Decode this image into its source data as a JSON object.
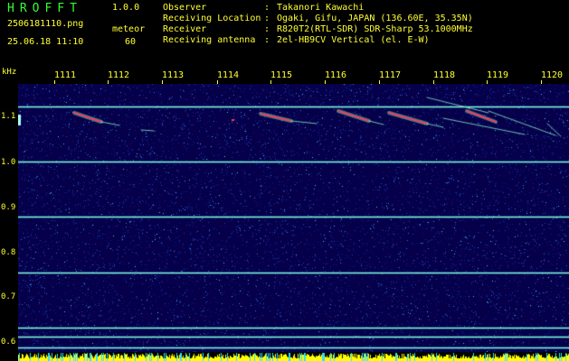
{
  "header": {
    "app_title": "HROFFT",
    "app_version": "1.0.0",
    "file_name": "2506181110.png",
    "meteor_label": "meteor",
    "date_time": "25.06.18 11:10",
    "meteor_count": "60"
  },
  "info": [
    {
      "label": "Observer",
      "value": "Takanori Kawachi"
    },
    {
      "label": "Receiving Location",
      "value": "Ogaki, Gifu, JAPAN (136.60E, 35.35N)"
    },
    {
      "label": "Receiver",
      "value": "R820T2(RTL-SDR) SDR-Sharp 53.1000MHz"
    },
    {
      "label": "Receiving antenna",
      "value": "2el-HB9CV Vertical (el. E-W)"
    }
  ],
  "axis": {
    "freq_unit": "kHz",
    "time_ticks": [
      "1111",
      "1112",
      "1113",
      "1114",
      "1115",
      "1116",
      "1117",
      "1118",
      "1119",
      "1120"
    ],
    "freq_ticks": [
      "1.1",
      "1.0",
      "0.9",
      "0.8",
      "0.7",
      "0.6"
    ]
  },
  "spectrogram": {
    "freq_range_khz": [
      0.585,
      1.165
    ],
    "carrier_lines_khz": [
      1.117,
      0.998,
      0.877,
      0.757,
      0.637,
      0.618,
      0.595
    ],
    "colors": {
      "background": "#06004a",
      "noise": "#1a46b0",
      "carrier": "#88ffdd",
      "echo_core": "#ff3366",
      "echo_halo": "#33ffaa",
      "power_bar": "#ffff00"
    }
  }
}
